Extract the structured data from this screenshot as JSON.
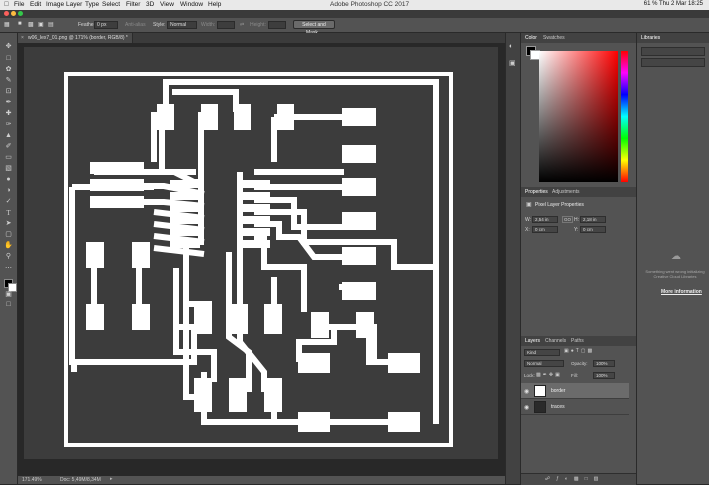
{
  "menubar": {
    "apple": "",
    "items": [
      "File",
      "Edit",
      "Image",
      "Layer",
      "Type",
      "Select",
      "Filter",
      "3D",
      "View",
      "Window",
      "Help"
    ],
    "app_title": "Adobe Photoshop CC 2017",
    "system": "61 %  Thu 2 Mar  18:25"
  },
  "options": {
    "feather_label": "Feather:",
    "feather_value": "0 px",
    "antialias_label": "Anti-alias",
    "style_label": "Style:",
    "style_value": "Normal",
    "width_label": "Width:",
    "height_label": "Height:",
    "select_mask_label": "Select and Mask..."
  },
  "document": {
    "tab_title": "w06_lex7_01.png @ 171% (border, RGB/8) *",
    "zoom": "171.49%",
    "doc_info": "Doc: 5,49M/8,34M"
  },
  "color_panel": {
    "tabs": [
      "Color",
      "Swatches"
    ],
    "hue_colors": [
      "#ff0000",
      "#ffff00",
      "#00ff00",
      "#00ffff",
      "#0000ff",
      "#ff00ff",
      "#ff0000"
    ],
    "base_hue": "#ff0000"
  },
  "properties_panel": {
    "tabs": [
      "Properties",
      "Adjustments"
    ],
    "heading": "Pixel Layer Properties",
    "w_label": "W:",
    "w_value": "2,54 in",
    "go_label": "GO",
    "h_label": "H:",
    "h_value": "2,18 in",
    "x_label": "X:",
    "x_value": "0 cm",
    "y_label": "Y:",
    "y_value": "0 cm"
  },
  "layers_panel": {
    "tabs": [
      "Layers",
      "Channels",
      "Paths"
    ],
    "kind_label": "Kind",
    "blend_mode": "Normal",
    "opacity_label": "Opacity:",
    "opacity_value": "100%",
    "lock_label": "Lock:",
    "fill_label": "Fill:",
    "fill_value": "100%",
    "layers": [
      {
        "name": "border",
        "thumb": "#ffffff"
      },
      {
        "name": "traces",
        "thumb": "#2a2a2a"
      }
    ]
  },
  "libraries_panel": {
    "tab": "Libraries",
    "message": "Something went wrong initializing Creative Cloud Libraries",
    "link": "More information"
  },
  "board_colors": {
    "border": "#ffffff",
    "trace": "#ffffff",
    "bg": "#3c3c3c",
    "canvas": "#282828"
  }
}
